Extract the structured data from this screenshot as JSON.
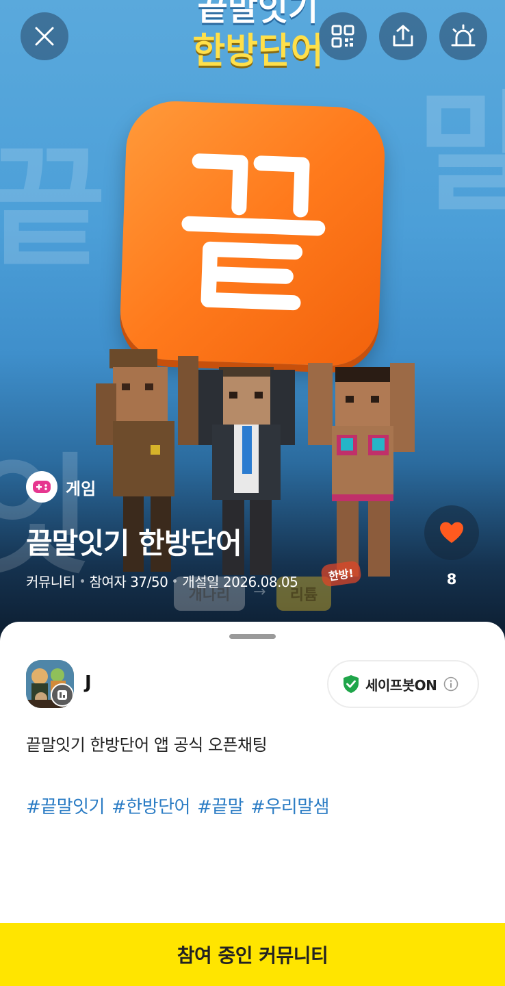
{
  "hero": {
    "app_name_art": [
      "끝말잇기",
      "한방단어"
    ],
    "logo_glyph": "끝",
    "bg_glyphs": [
      "끝",
      "말",
      "잇"
    ],
    "category": {
      "icon": "game-controller-icon",
      "label": "게임"
    },
    "title": "끝말잇기 한방단어",
    "meta": {
      "type": "커뮤니티",
      "participants": "참여자 37/50",
      "opened": "개설일 2026.08.05"
    },
    "like": {
      "icon": "heart-icon",
      "count": "8"
    },
    "banner_words": [
      "개나리",
      "리튬",
      "한방!"
    ]
  },
  "top_actions": [
    {
      "name": "close",
      "icon": "close-icon"
    },
    {
      "name": "qr",
      "icon": "qr-code-icon"
    },
    {
      "name": "share",
      "icon": "share-icon"
    },
    {
      "name": "report",
      "icon": "siren-icon"
    }
  ],
  "owner": {
    "name": "J",
    "badge_icon": "owner-badge-icon"
  },
  "safebot": {
    "label": "세이프봇ON",
    "icon": "shield-check-icon",
    "info_icon": "info-icon"
  },
  "description": "끝말잇기 한방단어 앱 공식 오픈채팅",
  "tags": [
    "#끝말잇기",
    "#한방단어",
    "#끝말",
    "#우리말샘"
  ],
  "join_button": "참여 중인 커뮤니티",
  "colors": {
    "accent_yellow": "#ffe500",
    "logo_orange": "#ff7a1c",
    "tag_blue": "#2b7cc4",
    "heart_orange": "#ff5a1f"
  }
}
